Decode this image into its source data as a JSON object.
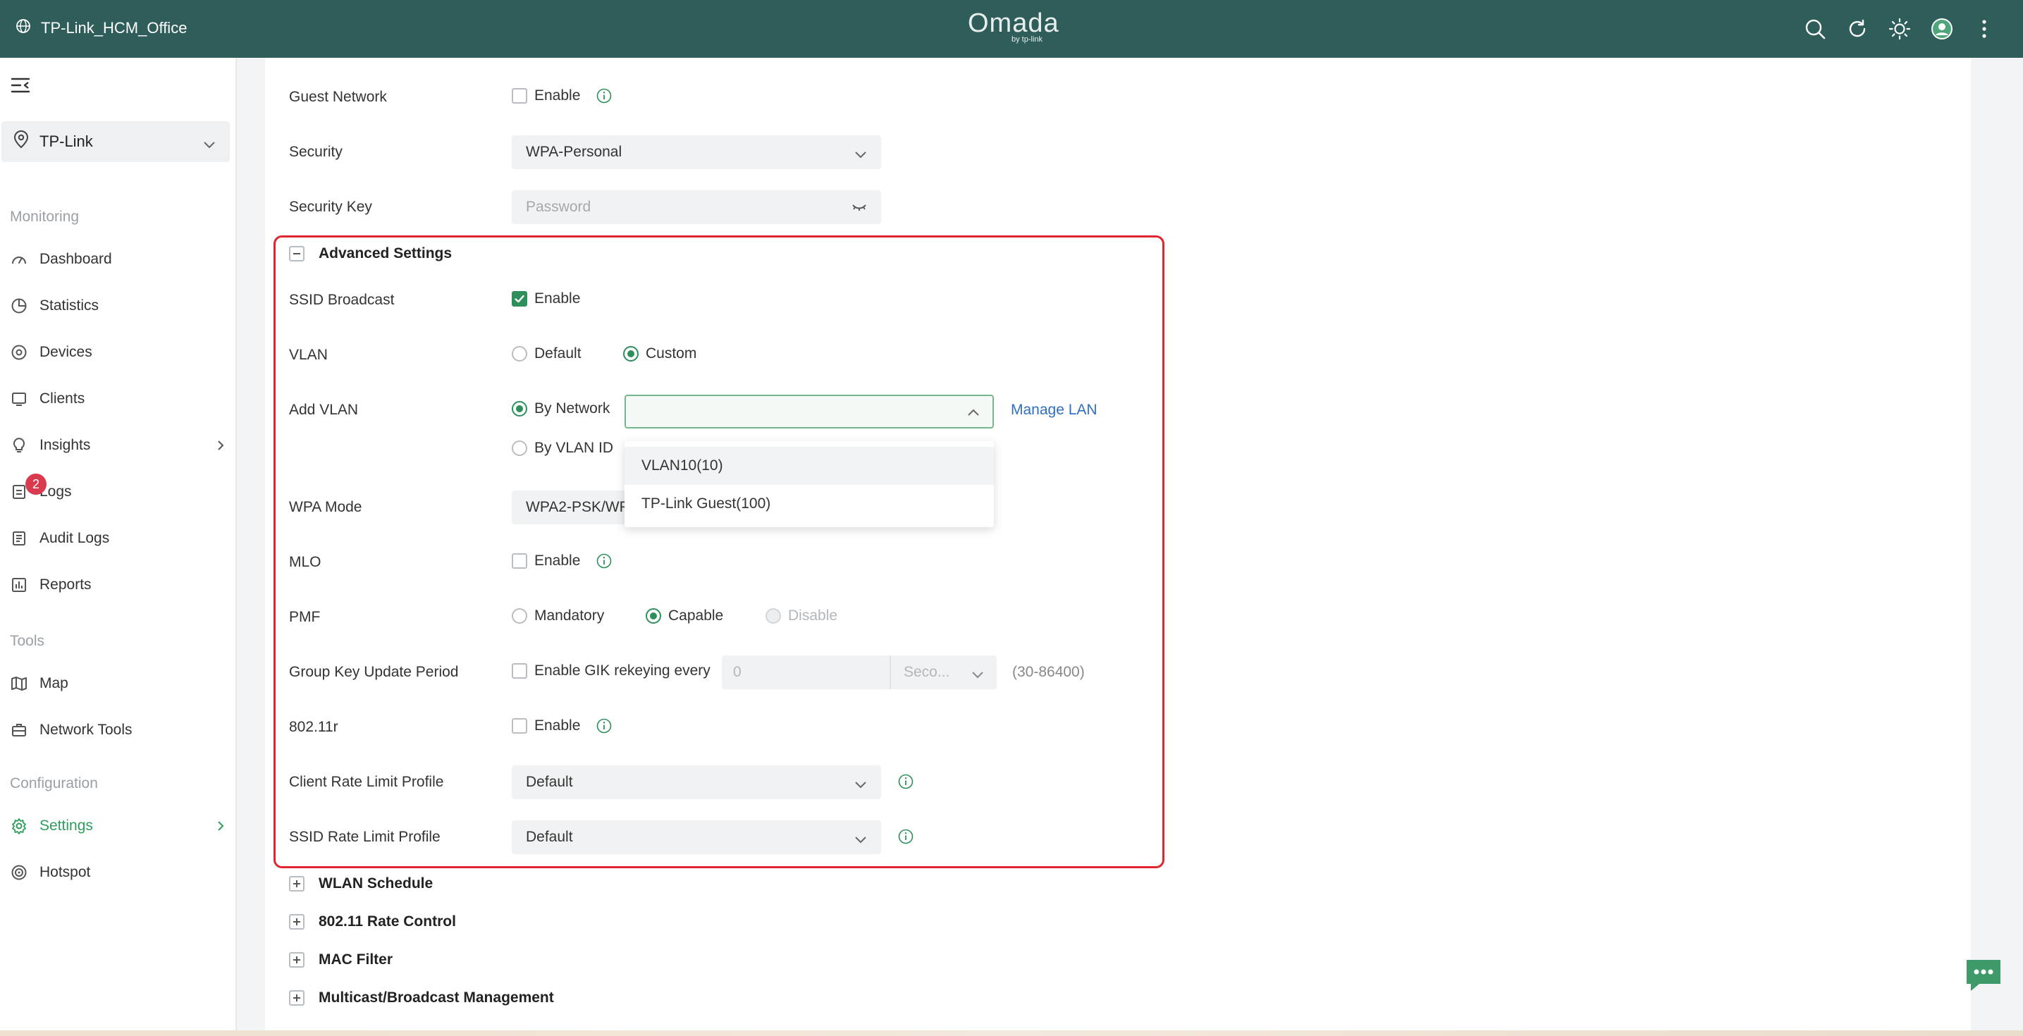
{
  "header": {
    "site_name": "TP-Link_HCM_Office",
    "logo_main": "Omada",
    "logo_sub": "by tp-link",
    "icons": [
      "search-icon",
      "refresh-icon",
      "theme-icon",
      "avatar-icon",
      "more-icon"
    ]
  },
  "sidebar": {
    "site_selector": "TP-Link",
    "sections": {
      "monitoring": "Monitoring",
      "tools": "Tools",
      "configuration": "Configuration"
    },
    "items": {
      "dashboard": "Dashboard",
      "statistics": "Statistics",
      "devices": "Devices",
      "clients": "Clients",
      "insights": "Insights",
      "logs": "Logs",
      "logs_badge": "2",
      "audit_logs": "Audit Logs",
      "reports": "Reports",
      "map": "Map",
      "network_tools": "Network Tools",
      "settings": "Settings",
      "hotspot": "Hotspot"
    }
  },
  "form": {
    "guest_network": {
      "label": "Guest Network",
      "option": "Enable",
      "checked": false
    },
    "security": {
      "label": "Security",
      "value": "WPA-Personal"
    },
    "security_key": {
      "label": "Security Key",
      "placeholder": "Password"
    },
    "advanced": {
      "title": "Advanced Settings",
      "ssid_broadcast": {
        "label": "SSID Broadcast",
        "option": "Enable",
        "checked": true
      },
      "vlan": {
        "label": "VLAN",
        "options": [
          "Default",
          "Custom"
        ],
        "selected": "Custom"
      },
      "add_vlan": {
        "label": "Add VLAN",
        "options": [
          "By Network",
          "By VLAN ID"
        ],
        "selected": "By Network",
        "value": "",
        "manage_link": "Manage LAN",
        "dropdown_items": [
          "VLAN10(10)",
          "TP-Link Guest(100)"
        ]
      },
      "wpa_mode": {
        "label": "WPA Mode",
        "value": "WPA2-PSK/WP"
      },
      "mlo": {
        "label": "MLO",
        "option": "Enable",
        "checked": false
      },
      "pmf": {
        "label": "PMF",
        "options": [
          "Mandatory",
          "Capable",
          "Disable"
        ],
        "selected": "Capable"
      },
      "gik": {
        "label": "Group Key Update Period",
        "option": "Enable GIK rekeying every",
        "value": "0",
        "unit": "Seco...",
        "range": "(30-86400)"
      },
      "r80211": {
        "label": "802.11r",
        "option": "Enable",
        "checked": false
      },
      "client_rate": {
        "label": "Client Rate Limit Profile",
        "value": "Default"
      },
      "ssid_rate": {
        "label": "SSID Rate Limit Profile",
        "value": "Default"
      }
    },
    "collapsed_sections": [
      "WLAN Schedule",
      "802.11 Rate Control",
      "MAC Filter",
      "Multicast/Broadcast Management"
    ]
  },
  "colors": {
    "header_bg": "#2f5d5a",
    "accent_green": "#2f8f5b",
    "highlight_red": "#e0262f",
    "link_blue": "#2f6fbf",
    "badge_red": "#d93a4d"
  }
}
